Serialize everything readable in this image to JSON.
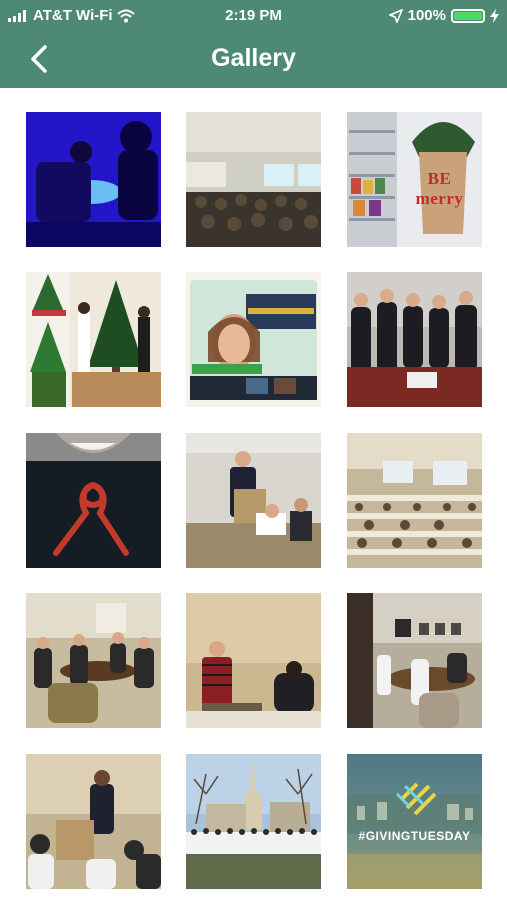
{
  "status_bar": {
    "carrier": "AT&T Wi-Fi",
    "time": "2:19 PM",
    "battery": "100%",
    "battery_level": 1.0
  },
  "header": {
    "title": "Gallery"
  },
  "gallery": {
    "photos": [
      {
        "name": "photo-1",
        "theme": "lab-blue-light"
      },
      {
        "name": "photo-2",
        "theme": "lecture-hall"
      },
      {
        "name": "photo-3",
        "theme": "be-merry-plant",
        "caption": "BE merry"
      },
      {
        "name": "photo-4",
        "theme": "christmas-trees"
      },
      {
        "name": "photo-5",
        "theme": "video-call-medicine"
      },
      {
        "name": "photo-6",
        "theme": "group-portrait"
      },
      {
        "name": "photo-7",
        "theme": "red-ribbon"
      },
      {
        "name": "photo-8",
        "theme": "speaker-podium"
      },
      {
        "name": "photo-9",
        "theme": "conference-room"
      },
      {
        "name": "photo-10",
        "theme": "meeting-table"
      },
      {
        "name": "photo-11",
        "theme": "speaker-red-jacket"
      },
      {
        "name": "photo-12",
        "theme": "board-meeting"
      },
      {
        "name": "photo-13",
        "theme": "podium-talk"
      },
      {
        "name": "photo-14",
        "theme": "campus-white-coats"
      },
      {
        "name": "photo-15",
        "theme": "giving-tuesday",
        "caption": "#GIVINGTUESDAY"
      }
    ]
  }
}
